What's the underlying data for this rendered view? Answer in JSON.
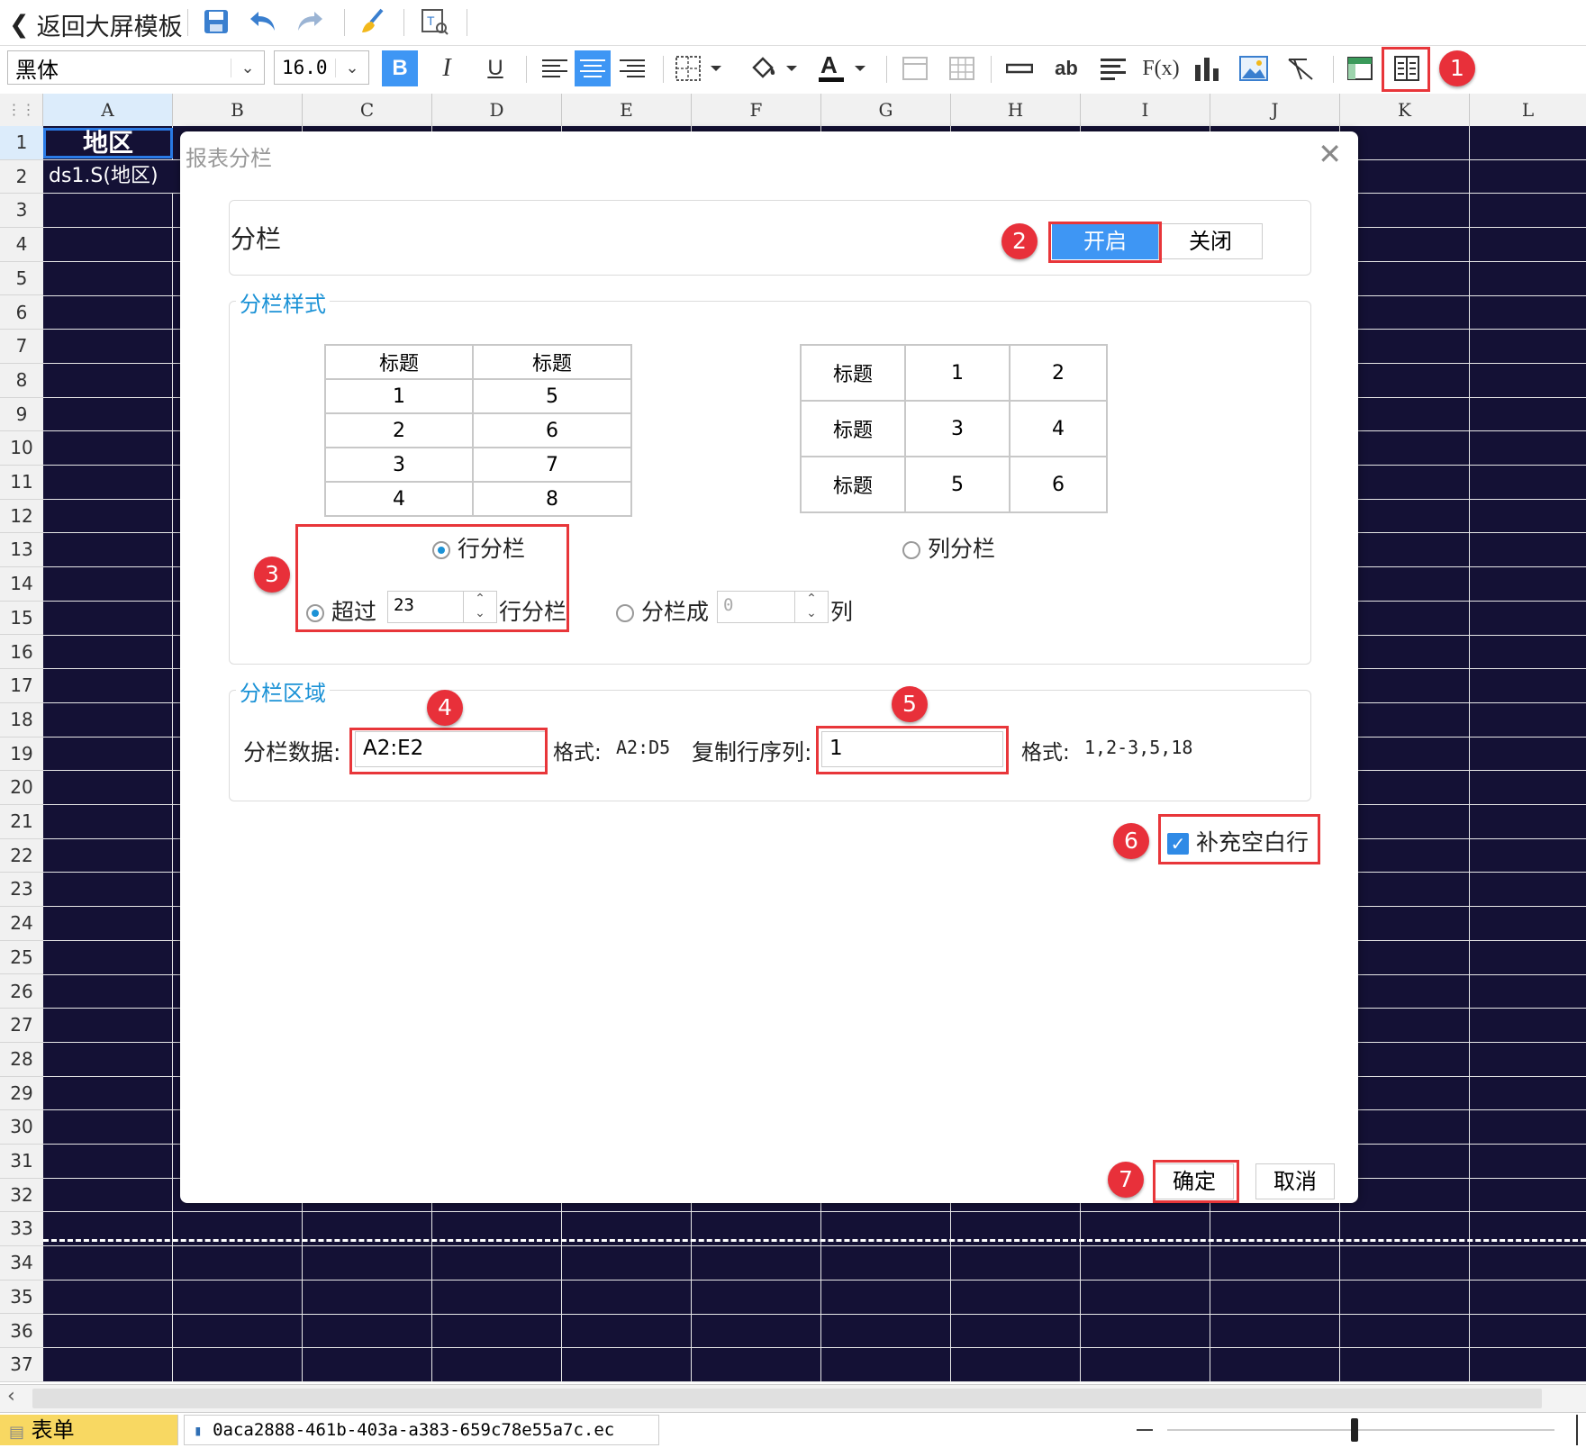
{
  "toolbar": {
    "back_label": "返回大屏模板"
  },
  "format": {
    "font_name": "黑体",
    "font_size": "16.0",
    "bold": "B",
    "italic": "I",
    "underline": "U",
    "text_icon": "ab",
    "formula_icon": "F(x)"
  },
  "columns": [
    "A",
    "B",
    "C",
    "D",
    "E",
    "F",
    "G",
    "H",
    "I",
    "J",
    "K",
    "L"
  ],
  "rows": [
    "1",
    "2",
    "3",
    "4",
    "5",
    "6",
    "7",
    "8",
    "9",
    "10",
    "11",
    "12",
    "13",
    "14",
    "15",
    "16",
    "17",
    "18",
    "19",
    "20",
    "21",
    "22",
    "23",
    "24",
    "25",
    "26",
    "27",
    "28",
    "29",
    "30",
    "31",
    "32",
    "33",
    "34",
    "35",
    "36",
    "37"
  ],
  "cells": {
    "a1": "地区",
    "a2": "ds1.S(地区)"
  },
  "dialog": {
    "title": "报表分栏",
    "columnization_label": "分栏",
    "toggle_on": "开启",
    "toggle_off": "关闭",
    "style_legend": "分栏样式",
    "row_preview": {
      "headers": [
        "标题",
        "标题"
      ],
      "rows": [
        [
          "1",
          "5"
        ],
        [
          "2",
          "6"
        ],
        [
          "3",
          "7"
        ],
        [
          "4",
          "8"
        ]
      ]
    },
    "col_preview": {
      "rows": [
        [
          "标题",
          "1",
          "2"
        ],
        [
          "标题",
          "3",
          "4"
        ],
        [
          "标题",
          "5",
          "6"
        ]
      ]
    },
    "row_mode_label": "行分栏",
    "col_mode_label": "列分栏",
    "exceed_label": "超过",
    "exceed_value": "23",
    "exceed_suffix": "行分栏",
    "split_into_label": "分栏成",
    "split_into_value": "0",
    "split_into_suffix": "列",
    "area_legend": "分栏区域",
    "data_label": "分栏数据:",
    "data_value": "A2:E2",
    "data_format_label": "格式:",
    "data_format_example": "A2:D5",
    "copy_rows_label": "复制行序列:",
    "copy_rows_value": "1",
    "copy_format_label": "格式:",
    "copy_format_example": "1,2-3,5,18",
    "fill_blank_label": "补充空白行",
    "ok_label": "确定",
    "cancel_label": "取消"
  },
  "badges": [
    "1",
    "2",
    "3",
    "4",
    "5",
    "6",
    "7"
  ],
  "status": {
    "sheet_tab": "表单",
    "file_tab": "0aca2888-461b-403a-a383-659c78e55a7c.ec"
  },
  "colors": {
    "sheet_bg": "#141135",
    "accent": "#1b92d6",
    "annotation_red": "#e8303a",
    "toggle_on_bg": "#3e96f4"
  }
}
